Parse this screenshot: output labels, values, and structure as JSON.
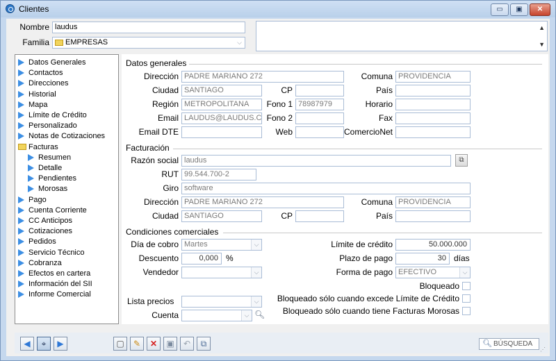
{
  "window": {
    "title": "Clientes",
    "buttons": {
      "minimize": "▭",
      "maximize": "▣",
      "close": "✕"
    }
  },
  "header": {
    "nombre_label": "Nombre",
    "nombre_value": "laudus",
    "familia_label": "Familia",
    "familia_value": "EMPRESAS"
  },
  "tree": {
    "items": [
      {
        "label": "Datos Generales",
        "icon": "arrow-right-icon"
      },
      {
        "label": "Contactos",
        "icon": "arrow-right-icon"
      },
      {
        "label": "Direcciones",
        "icon": "arrow-right-icon"
      },
      {
        "label": "Historial",
        "icon": "arrow-right-icon"
      },
      {
        "label": "Mapa",
        "icon": "arrow-right-icon"
      },
      {
        "label": "Límite de Crédito",
        "icon": "arrow-right-icon"
      },
      {
        "label": "Personalizado",
        "icon": "arrow-right-icon"
      },
      {
        "label": "Notas de Cotizaciones",
        "icon": "arrow-right-icon"
      },
      {
        "label": "Facturas",
        "icon": "folder-open-icon"
      },
      {
        "label": "Resumen",
        "icon": "arrow-right-icon"
      },
      {
        "label": "Detalle",
        "icon": "arrow-right-icon"
      },
      {
        "label": "Pendientes",
        "icon": "arrow-right-icon"
      },
      {
        "label": "Morosas",
        "icon": "arrow-right-icon"
      },
      {
        "label": "Pago",
        "icon": "arrow-right-icon"
      },
      {
        "label": "Cuenta Corriente",
        "icon": "arrow-right-icon"
      },
      {
        "label": "CC Anticipos",
        "icon": "arrow-right-icon"
      },
      {
        "label": "Cotizaciones",
        "icon": "arrow-right-icon"
      },
      {
        "label": "Pedidos",
        "icon": "arrow-right-icon"
      },
      {
        "label": "Servicio Técnico",
        "icon": "arrow-right-icon"
      },
      {
        "label": "Cobranza",
        "icon": "arrow-right-icon"
      },
      {
        "label": "Efectos en cartera",
        "icon": "arrow-right-icon"
      },
      {
        "label": "Información del SII",
        "icon": "arrow-right-icon"
      },
      {
        "label": "Informe Comercial",
        "icon": "arrow-right-icon"
      }
    ]
  },
  "datos_generales": {
    "section": "Datos generales",
    "direccion_label": "Dirección",
    "direccion": "PADRE MARIANO 272",
    "comuna_label": "Comuna",
    "comuna": "PROVIDENCIA",
    "ciudad_label": "Ciudad",
    "ciudad": "SANTIAGO",
    "cp_label": "CP",
    "cp": "",
    "pais_label": "País",
    "pais": "",
    "region_label": "Región",
    "region": "METROPOLITANA",
    "fono1_label": "Fono 1",
    "fono1": "78987979",
    "horario_label": "Horario",
    "horario": "",
    "email_label": "Email",
    "email": "LAUDUS@LAUDUS.CL",
    "fono2_label": "Fono 2",
    "fono2": "",
    "fax_label": "Fax",
    "fax": "",
    "email_dte_label": "Email DTE",
    "email_dte": "",
    "web_label": "Web",
    "web": "",
    "comercionet_label": "ComercioNet",
    "comercionet": ""
  },
  "facturacion": {
    "section": "Facturación",
    "razon_social_label": "Razón social",
    "razon_social": "laudus",
    "rut_label": "RUT",
    "rut": "99.544.700-2",
    "giro_label": "Giro",
    "giro": "software",
    "direccion_label": "Dirección",
    "direccion": "PADRE MARIANO 272",
    "comuna_label": "Comuna",
    "comuna": "PROVIDENCIA",
    "ciudad_label": "Ciudad",
    "ciudad": "SANTIAGO",
    "cp_label": "CP",
    "cp": "",
    "pais_label": "País",
    "pais": ""
  },
  "condiciones": {
    "section": "Condiciones comerciales",
    "dia_cobro_label": "Día de cobro",
    "dia_cobro": "Martes",
    "descuento_label": "Descuento",
    "descuento": "0,000",
    "descuento_unit": "%",
    "vendedor_label": "Vendedor",
    "vendedor": "",
    "limite_credito_label": "Límite de crédito",
    "limite_credito": "50.000.000",
    "plazo_pago_label": "Plazo de pago",
    "plazo_pago": "30",
    "plazo_unit": "días",
    "forma_pago_label": "Forma de pago",
    "forma_pago": "EFECTIVO",
    "bloqueado_label": "Bloqueado",
    "bloq_limite_label": "Bloqueado sólo cuando excede Límite de Crédito",
    "bloq_morosas_label": "Bloqueado sólo cuando tiene Facturas Morosas",
    "lista_precios_label": "Lista precios",
    "lista_precios": "",
    "cuenta_label": "Cuenta",
    "cuenta": ""
  },
  "toolbar": {
    "search_label": "BÚSQUEDA"
  },
  "colors": {
    "frame": "#c5d8ee",
    "accent_arrow": "#3d8fe4",
    "delete_red": "#d42020"
  }
}
